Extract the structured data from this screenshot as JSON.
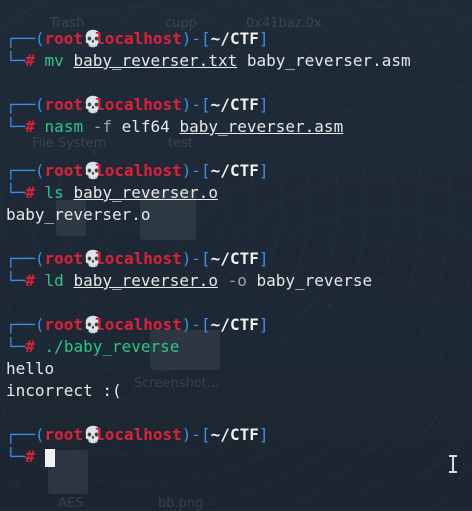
{
  "background_labels": [
    "Trash",
    "cupp",
    "0x41baz.0x",
    "File System",
    "test",
    "Screenshot...",
    "AES",
    "bb.png"
  ],
  "prompt": {
    "bracket_open": "┌──(",
    "user": "root",
    "skull": "💀",
    "host": "localhost",
    "sep": ")-[",
    "path": "~/CTF",
    "bracket_close": "]",
    "corner": "└─",
    "hash": "#"
  },
  "blocks": [
    {
      "command": "mv",
      "args": [
        {
          "text": "baby_reverser.txt",
          "underline": true
        },
        {
          "text": "baby_reverser.asm",
          "underline": false
        }
      ],
      "output": []
    },
    {
      "command": "nasm",
      "args": [
        {
          "text": "-f",
          "option": true
        },
        {
          "text": "elf64",
          "underline": false
        },
        {
          "text": "baby_reverser.asm",
          "underline": true
        }
      ],
      "output": []
    },
    {
      "command": "ls",
      "args": [
        {
          "text": "baby_reverser.o",
          "underline": true
        }
      ],
      "output": [
        "baby_reverser.o"
      ]
    },
    {
      "command": "ld",
      "args": [
        {
          "text": "baby_reverser.o",
          "underline": true
        },
        {
          "text": "-o",
          "option": true
        },
        {
          "text": "baby_reverse",
          "underline": false
        }
      ],
      "output": []
    },
    {
      "command": "./baby_reverse",
      "args": [],
      "output": [
        "hello",
        "incorrect :("
      ]
    }
  ],
  "colors": {
    "background": "#1e2a36",
    "prompt_red": "#e0203a",
    "bracket_blue": "#3b8eea",
    "command_green": "#2ec58c"
  }
}
